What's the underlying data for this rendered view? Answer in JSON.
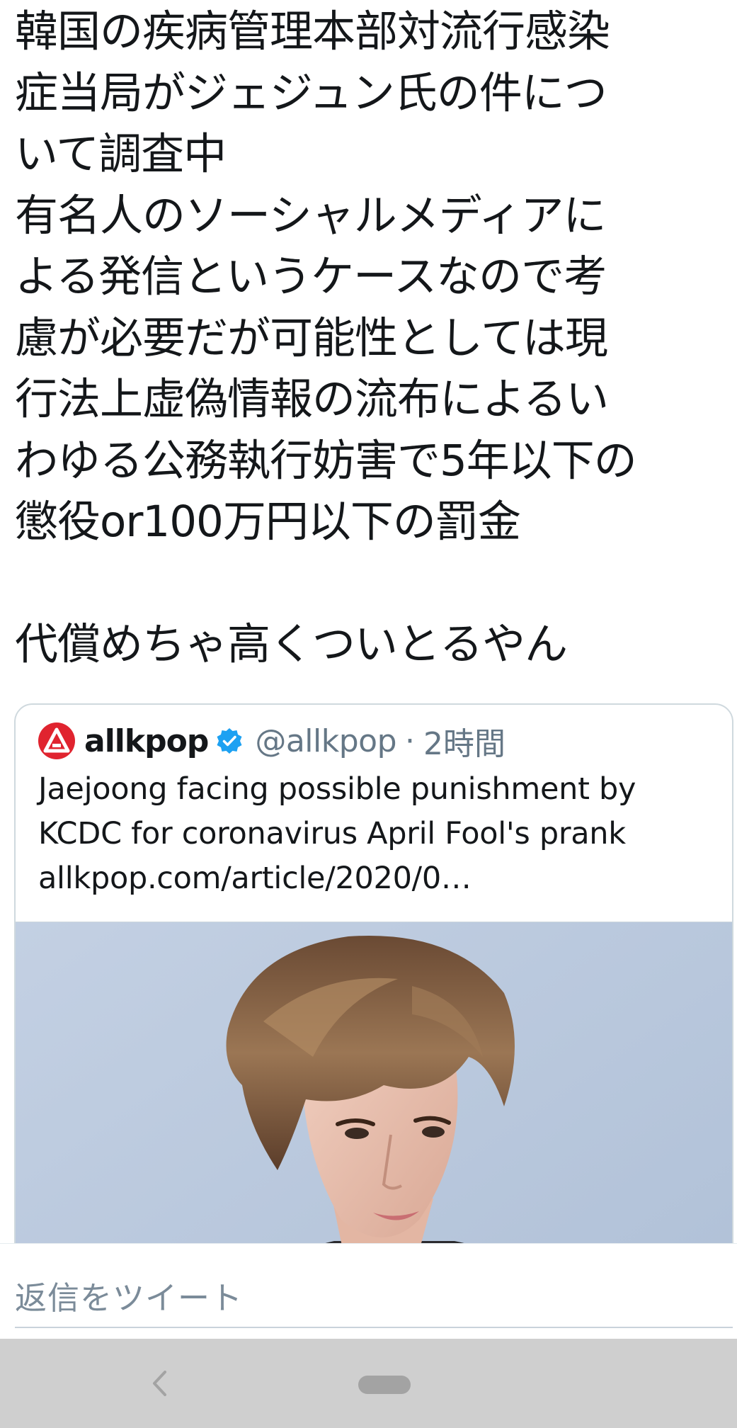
{
  "tweet": {
    "lines": [
      "韓国の疾病管理本部対流行感染",
      "症当局がジェジュン氏の件につ",
      "いて調査中",
      "有名人のソーシャルメディアに",
      "よる発信というケースなので考",
      "慮が必要だが可能性としては現",
      "行法上虚偽情報の流布によるい",
      "わゆる公務執行妨害で5年以下の",
      "懲役or100万円以下の罰金"
    ],
    "comment": "代償めちゃ高くついとるやん"
  },
  "quote": {
    "account_name": "allkpop",
    "handle": "@allkpop",
    "separator": "·",
    "time": "2時間",
    "text_lines": [
      "Jaejoong facing possible punishment by",
      "KCDC for coronavirus April Fool's prank",
      "allkpop.com/article/2020/0…"
    ],
    "logo_icon": "allkpop-logo-icon",
    "verified_icon": "verified-badge-icon",
    "image_icon": "portrait-photo"
  },
  "reply": {
    "placeholder": "返信をツイート"
  },
  "nav": {
    "back_icon": "back-chevron-icon",
    "home_icon": "home-pill-icon"
  },
  "colors": {
    "text": "#14171a",
    "secondary": "#657786",
    "verified": "#1da1f2",
    "logo": "#e0242f",
    "nav_bg": "#cfcfcf"
  }
}
